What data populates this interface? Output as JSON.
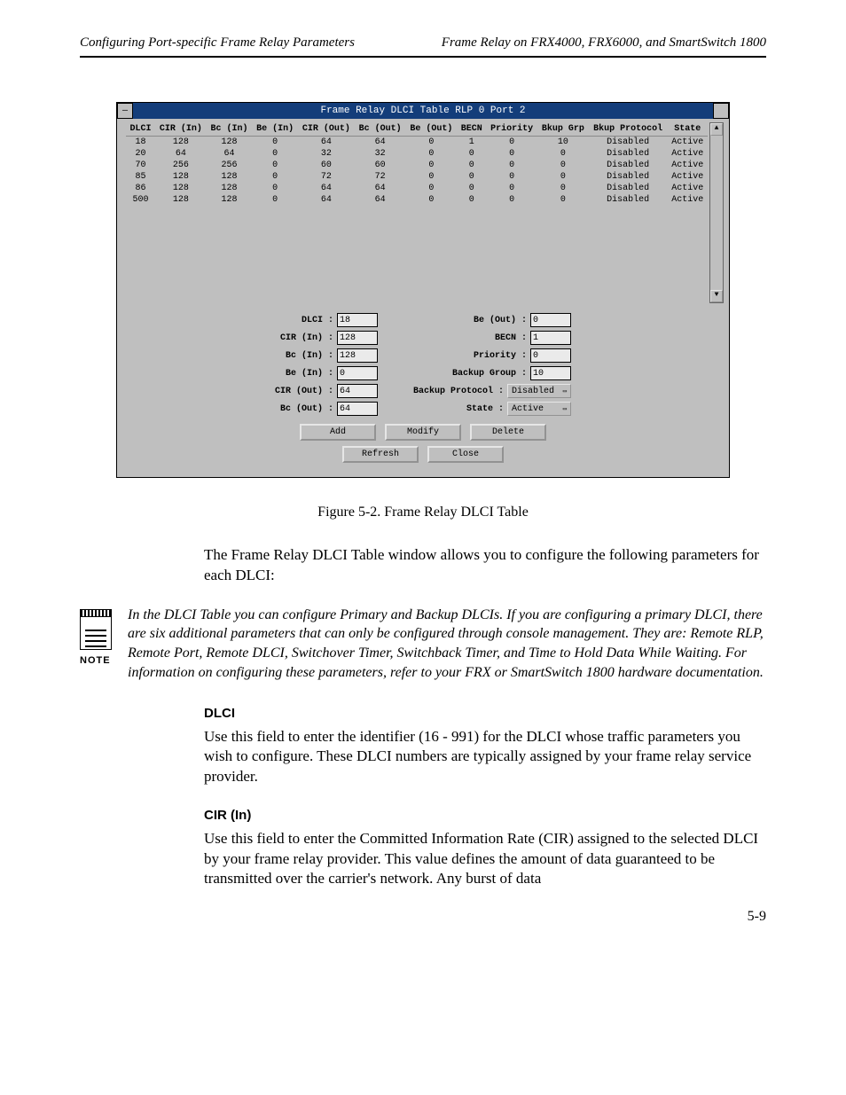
{
  "header": {
    "left": "Configuring Port-specific Frame Relay Parameters",
    "right": "Frame Relay on FRX4000, FRX6000, and SmartSwitch 1800"
  },
  "win": {
    "title": "Frame Relay DLCI Table  RLP 0 Port 2",
    "columns": [
      "DLCI",
      "CIR (In)",
      "Bc (In)",
      "Be (In)",
      "CIR (Out)",
      "Bc (Out)",
      "Be (Out)",
      "BECN",
      "Priority",
      "Bkup Grp",
      "Bkup Protocol",
      "State"
    ],
    "rows": [
      [
        "18",
        "128",
        "128",
        "0",
        "64",
        "64",
        "0",
        "1",
        "0",
        "10",
        "Disabled",
        "Active"
      ],
      [
        "20",
        "64",
        "64",
        "0",
        "32",
        "32",
        "0",
        "0",
        "0",
        "0",
        "Disabled",
        "Active"
      ],
      [
        "70",
        "256",
        "256",
        "0",
        "60",
        "60",
        "0",
        "0",
        "0",
        "0",
        "Disabled",
        "Active"
      ],
      [
        "85",
        "128",
        "128",
        "0",
        "72",
        "72",
        "0",
        "0",
        "0",
        "0",
        "Disabled",
        "Active"
      ],
      [
        "86",
        "128",
        "128",
        "0",
        "64",
        "64",
        "0",
        "0",
        "0",
        "0",
        "Disabled",
        "Active"
      ],
      [
        "500",
        "128",
        "128",
        "0",
        "64",
        "64",
        "0",
        "0",
        "0",
        "0",
        "Disabled",
        "Active"
      ]
    ],
    "form_left": [
      {
        "label": "DLCI :",
        "value": "18"
      },
      {
        "label": "CIR (In) :",
        "value": "128"
      },
      {
        "label": "Bc (In) :",
        "value": "128"
      },
      {
        "label": "Be (In) :",
        "value": "0"
      },
      {
        "label": "CIR (Out) :",
        "value": "64"
      },
      {
        "label": "Bc (Out) :",
        "value": "64"
      }
    ],
    "form_right_inputs": [
      {
        "label": "Be (Out) :",
        "value": "0"
      },
      {
        "label": "BECN :",
        "value": "1"
      },
      {
        "label": "Priority :",
        "value": "0"
      },
      {
        "label": "Backup Group :",
        "value": "10"
      }
    ],
    "form_right_drops": [
      {
        "label": "Backup Protocol :",
        "value": "Disabled"
      },
      {
        "label": "State :",
        "value": "Active"
      }
    ],
    "buttons1": [
      "Add",
      "Modify",
      "Delete"
    ],
    "buttons2": [
      "Refresh",
      "Close"
    ]
  },
  "caption": "Figure 5-2. Frame Relay DLCI Table",
  "intro": "The Frame Relay DLCI Table window allows you to configure the following parameters for each DLCI:",
  "note_label": "NOTE",
  "note": "In the DLCI Table you can configure Primary and Backup DLCIs. If you are configuring a primary DLCI, there are six additional parameters that can only be configured through console management. They are: Remote RLP, Remote Port, Remote DLCI, Switchover Timer, Switchback Timer, and Time to Hold Data While Waiting. For information on configuring these parameters, refer to your FRX or SmartSwitch 1800 hardware documentation.",
  "sec_dlci": {
    "title": "DLCI",
    "text": "Use this field to enter the identifier (16 - 991) for the DLCI whose traffic parameters you wish to configure. These DLCI numbers are typically assigned by your frame relay service provider."
  },
  "sec_cir": {
    "title": "CIR (In)",
    "text": "Use this field to enter the Committed Information Rate (CIR) assigned to the selected DLCI by your frame relay provider. This value defines the amount of data guaranteed to be transmitted over the carrier's network. Any burst of data"
  },
  "page_number": "5-9"
}
